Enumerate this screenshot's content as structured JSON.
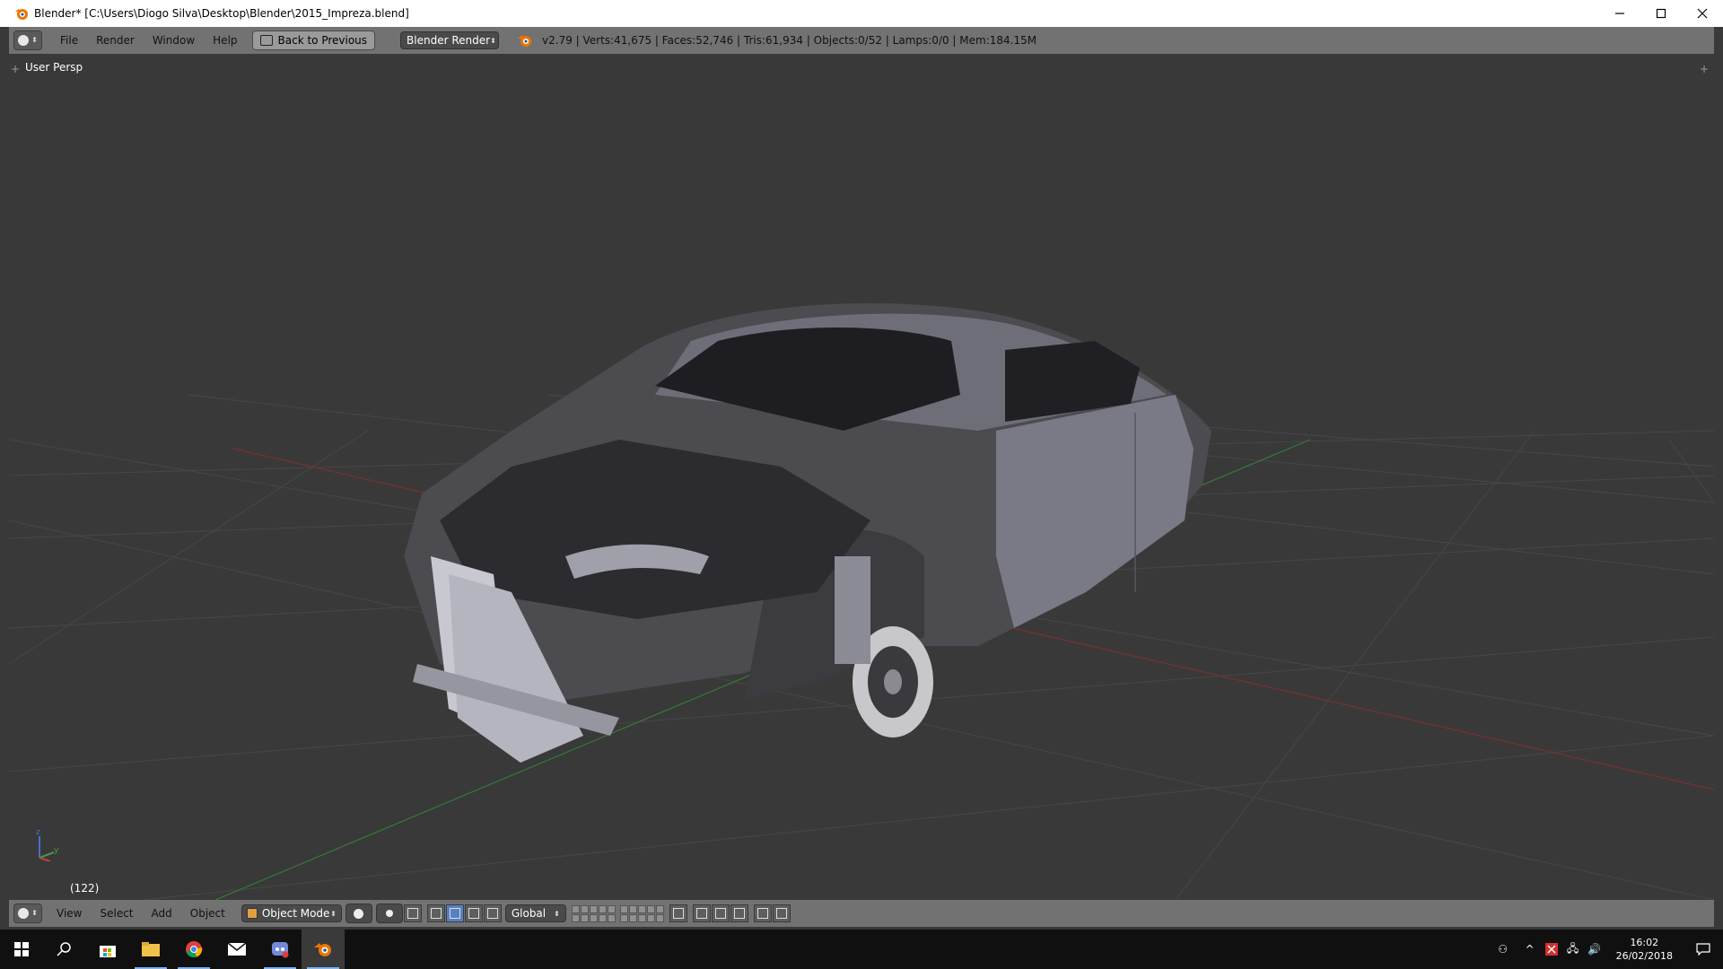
{
  "window": {
    "title": "Blender* [C:\\Users\\Diogo Silva\\Desktop\\Blender\\2015_Impreza.blend]",
    "controls": [
      "minimize-icon",
      "maximize-icon",
      "close-icon"
    ]
  },
  "info_header": {
    "editor_type_icon": "info-icon",
    "menus": [
      "File",
      "Render",
      "Window",
      "Help"
    ],
    "back_button": "Back to Previous",
    "render_engine": "Blender Render",
    "stats": "v2.79 | Verts:41,675 | Faces:52,746 | Tris:61,934 | Objects:0/52 | Lamps:0/0 | Mem:184.15M"
  },
  "viewport": {
    "view_name": "User Persp",
    "frame": "(122)",
    "axis_labels": {
      "z": "z",
      "y": "y"
    }
  },
  "view_header": {
    "menus": [
      "View",
      "Select",
      "Add",
      "Object"
    ],
    "mode": "Object Mode",
    "orientation": "Global"
  },
  "taskbar": {
    "apps": [
      "windows-start-icon",
      "search-icon",
      "store-icon",
      "file-explorer-icon",
      "chrome-icon",
      "mail-icon",
      "discord-icon",
      "blender-icon"
    ],
    "time": "16:02",
    "date": "26/02/2018"
  },
  "colors": {
    "viewport_bg": "#393939",
    "header_bg": "#727272",
    "grid": "#4a4a4a",
    "x_axis": "#8a3a3a",
    "y_axis": "#3f8a3f",
    "accent": "#5680c2"
  }
}
